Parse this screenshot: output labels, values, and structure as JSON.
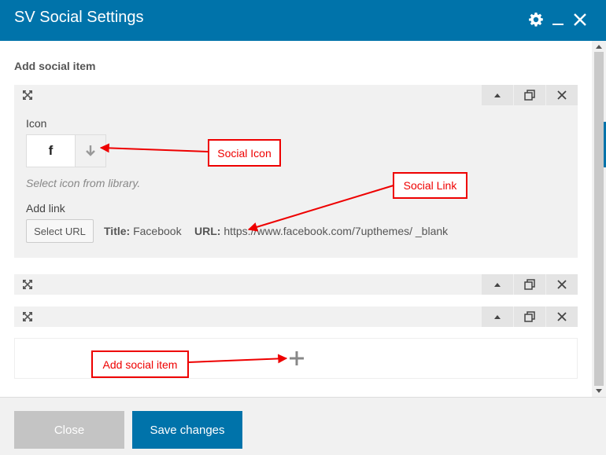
{
  "dialog": {
    "title": "SV Social Settings",
    "icons": {
      "settings": "gear-icon",
      "minimize": "minimize-icon",
      "close": "close-icon"
    }
  },
  "section": {
    "title": "Add social item"
  },
  "item": {
    "icon_label": "Icon",
    "icon_glyph": "f",
    "icon_hint": "Select icon from library.",
    "link_label": "Add link",
    "select_url_label": "Select URL",
    "title_label": "Title:",
    "title_value": "Facebook",
    "url_label": "URL:",
    "url_value": "https://www.facebook.com/7upthemes/ _blank"
  },
  "item_controls": [
    "move-icon",
    "collapse-icon",
    "duplicate-icon",
    "remove-icon"
  ],
  "footer": {
    "close_label": "Close",
    "save_label": "Save changes"
  },
  "annotations": {
    "social_icon": "Social Icon",
    "social_link": "Social Link",
    "add_social_item": "Add social item"
  },
  "colors": {
    "accent": "#0073aa",
    "annotation": "#e00000",
    "panel": "#f1f1f1",
    "disabled": "#c4c4c4"
  }
}
